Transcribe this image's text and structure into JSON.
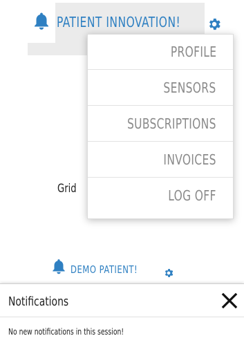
{
  "header": {
    "user_name": "PATIENT INNOVATION!",
    "bell_icon": "bell-icon",
    "settings_icon": "gear-icon"
  },
  "dropdown_menu": {
    "items": [
      {
        "label": "PROFILE"
      },
      {
        "label": "SENSORS"
      },
      {
        "label": "SUBSCRIPTIONS"
      },
      {
        "label": "INVOICES"
      },
      {
        "label": "LOG OFF"
      }
    ]
  },
  "background_text": "Grid",
  "header_2": {
    "user_name": "DEMO PATIENT!",
    "bell_icon": "bell-icon",
    "settings_icon": "gear-icon"
  },
  "notifications": {
    "title": "Notifications",
    "close_icon": "close-icon",
    "message": "No new notifications in this session!"
  },
  "colors": {
    "accent": "#2f80c2",
    "menu_text": "#8a8a8a",
    "hover_bg": "#ebebeb"
  }
}
